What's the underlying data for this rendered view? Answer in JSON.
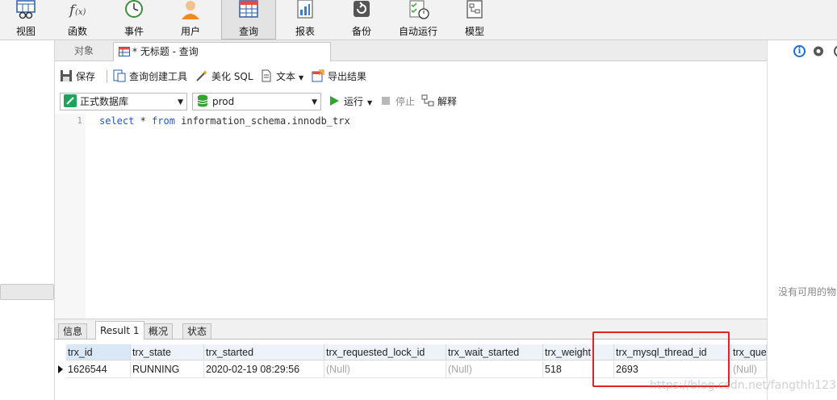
{
  "ribbon": {
    "items": [
      {
        "label": "视图",
        "icon": "view-icon"
      },
      {
        "label": "函数",
        "icon": "function-icon"
      },
      {
        "label": "事件",
        "icon": "event-clock-icon"
      },
      {
        "label": "用户",
        "icon": "user-icon"
      },
      {
        "label": "查询",
        "icon": "query-table-icon",
        "active": true
      },
      {
        "label": "报表",
        "icon": "report-icon"
      },
      {
        "label": "备份",
        "icon": "backup-icon"
      },
      {
        "label": "自动运行",
        "icon": "auto-run-icon"
      },
      {
        "label": "模型",
        "icon": "model-icon"
      }
    ]
  },
  "tabs": {
    "objects_label": "对象",
    "query_tab_label": "* 无标题 - 查询"
  },
  "toolbar": {
    "save": "保存",
    "query_builder": "查询创建工具",
    "beautify_sql": "美化 SQL",
    "text": "文本",
    "export_results": "导出结果",
    "connection": "正式数据库",
    "database": "prod",
    "run": "运行",
    "stop": "停止",
    "explain": "解释"
  },
  "editor": {
    "line_number": "1",
    "kw_select": "select",
    "star": " * ",
    "kw_from": "from",
    "table": " information_schema.innodb_trx"
  },
  "result_tabs": [
    "信息",
    "Result 1",
    "概况",
    "状态"
  ],
  "grid": {
    "columns": [
      "trx_id",
      "trx_state",
      "trx_started",
      "trx_requested_lock_id",
      "trx_wait_started",
      "trx_weight",
      "trx_mysql_thread_id",
      "trx_que"
    ],
    "row": [
      "1626544",
      "RUNNING",
      "2020-02-19 08:29:56",
      "(Null)",
      "(Null)",
      "518",
      "2693",
      "(Null)"
    ]
  },
  "right_panel": {
    "empty_text": "没有可用的物"
  },
  "watermark": "https://blog.csdn.net/fangthh123",
  "colors": {
    "accent_blue": "#1e6fd0",
    "keyword_blue": "#1f55d6",
    "highlight_red": "#e02222",
    "run_green": "#2fa52f"
  }
}
